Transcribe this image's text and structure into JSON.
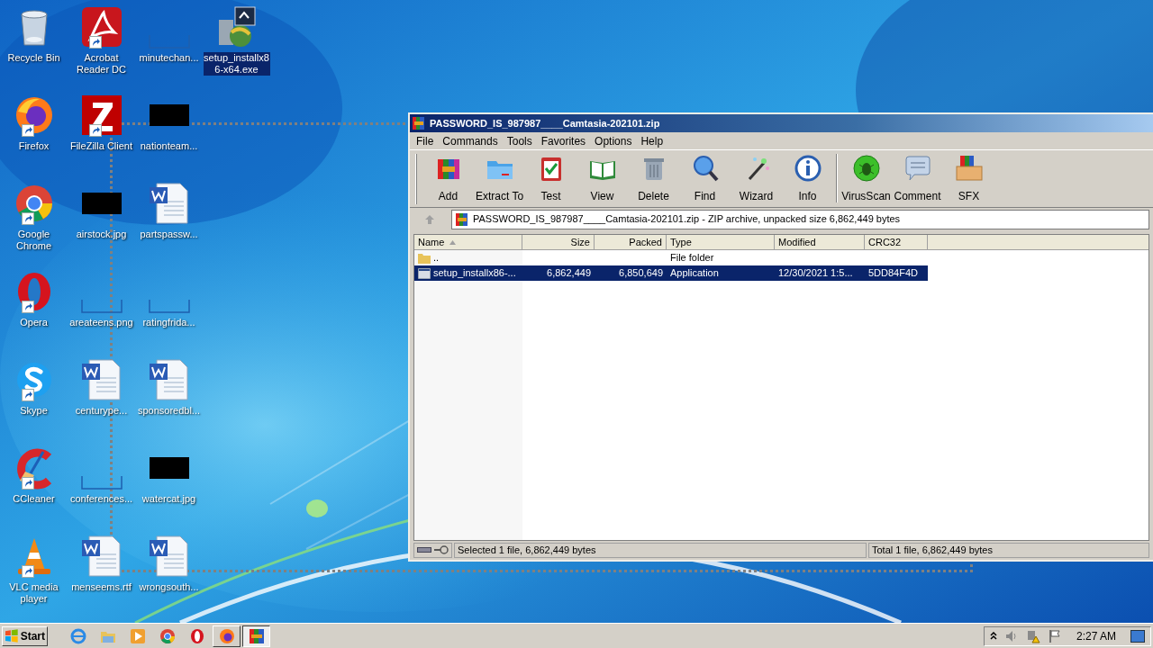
{
  "desktop": {
    "icons": [
      {
        "label": "Recycle Bin",
        "kind": "recycle",
        "shortcut": false,
        "selected": false
      },
      {
        "label": "Firefox",
        "kind": "firefox",
        "shortcut": true,
        "selected": false
      },
      {
        "label": "Google Chrome",
        "kind": "chrome",
        "shortcut": true,
        "selected": false
      },
      {
        "label": "Opera",
        "kind": "opera",
        "shortcut": true,
        "selected": false
      },
      {
        "label": "Skype",
        "kind": "skype",
        "shortcut": true,
        "selected": false
      },
      {
        "label": "CCleaner",
        "kind": "ccleaner",
        "shortcut": true,
        "selected": false
      },
      {
        "label": "VLC media player",
        "kind": "vlc",
        "shortcut": true,
        "selected": false
      },
      {
        "label": "Acrobat Reader DC",
        "kind": "pdf",
        "shortcut": true,
        "selected": false
      },
      {
        "label": "FileZilla Client",
        "kind": "filezilla",
        "shortcut": true,
        "selected": false
      },
      {
        "label": "airstock.jpg",
        "kind": "dark-thumb",
        "shortcut": false,
        "selected": false
      },
      {
        "label": "areateens.png",
        "kind": "blank-thumb",
        "shortcut": false,
        "selected": false
      },
      {
        "label": "centurype...",
        "kind": "word",
        "shortcut": false,
        "selected": false
      },
      {
        "label": "conferences...",
        "kind": "blank-thumb",
        "shortcut": false,
        "selected": false
      },
      {
        "label": "menseems.rtf",
        "kind": "word",
        "shortcut": false,
        "selected": false
      },
      {
        "label": "minutechan...",
        "kind": "blank-thumb",
        "shortcut": false,
        "selected": false
      },
      {
        "label": "nationteam...",
        "kind": "dark-thumb",
        "shortcut": false,
        "selected": false
      },
      {
        "label": "partspassw...",
        "kind": "word",
        "shortcut": false,
        "selected": false
      },
      {
        "label": "ratingfrida...",
        "kind": "blank-thumb",
        "shortcut": false,
        "selected": false
      },
      {
        "label": "sponsoredbl...",
        "kind": "word",
        "shortcut": false,
        "selected": false
      },
      {
        "label": "watercat.jpg",
        "kind": "dark-thumb",
        "shortcut": false,
        "selected": false
      },
      {
        "label": "wrongsouth...",
        "kind": "word",
        "shortcut": false,
        "selected": false
      },
      {
        "label": "setup_installx86-x64.exe",
        "kind": "installer",
        "shortcut": false,
        "selected": true
      }
    ]
  },
  "window": {
    "title": "PASSWORD_IS_987987____Camtasia-202101.zip",
    "menu": [
      "File",
      "Commands",
      "Tools",
      "Favorites",
      "Options",
      "Help"
    ],
    "toolbar": [
      {
        "label": "Add",
        "kind": "add"
      },
      {
        "label": "Extract To",
        "kind": "extract"
      },
      {
        "label": "Test",
        "kind": "test"
      },
      {
        "label": "View",
        "kind": "view"
      },
      {
        "label": "Delete",
        "kind": "delete"
      },
      {
        "label": "Find",
        "kind": "find"
      },
      {
        "label": "Wizard",
        "kind": "wizard"
      },
      {
        "label": "Info",
        "kind": "info"
      },
      {
        "label": "VirusScan",
        "kind": "virusscan"
      },
      {
        "label": "Comment",
        "kind": "comment"
      },
      {
        "label": "SFX",
        "kind": "sfx"
      }
    ],
    "address": "PASSWORD_IS_987987____Camtasia-202101.zip - ZIP archive, unpacked size 6,862,449 bytes",
    "table": {
      "columns": [
        {
          "label": "Name",
          "sorted": true
        },
        {
          "label": "Size",
          "sorted": false
        },
        {
          "label": "Packed",
          "sorted": false
        },
        {
          "label": "Type",
          "sorted": false
        },
        {
          "label": "Modified",
          "sorted": false
        },
        {
          "label": "CRC32",
          "sorted": false
        }
      ],
      "rows": [
        {
          "kind": "folder",
          "selected": false,
          "cells": {
            "name": "..",
            "type": "File folder"
          }
        },
        {
          "kind": "application",
          "selected": true,
          "cells": {
            "name": "setup_installx86-...",
            "size": "6,862,449",
            "packed": "6,850,649",
            "type": "Application",
            "modified": "12/30/2021 1:5...",
            "crc32": "5DD84F4D"
          }
        }
      ]
    },
    "status_bar": {
      "left": "Selected 1 file, 6,862,449 bytes",
      "right": "Total 1 file, 6,862,449 bytes"
    }
  },
  "taskbar": {
    "start": "Start",
    "apps": [
      {
        "kind": "ie",
        "open": false,
        "selected": false
      },
      {
        "kind": "explorer",
        "open": false,
        "selected": false
      },
      {
        "kind": "media",
        "open": false,
        "selected": false
      },
      {
        "kind": "chrome",
        "open": false,
        "selected": false
      },
      {
        "kind": "opera",
        "open": false,
        "selected": false
      },
      {
        "kind": "firefox",
        "open": true,
        "selected": false
      },
      {
        "kind": "winrar",
        "open": true,
        "selected": true
      }
    ],
    "clock": "2:27 AM"
  }
}
